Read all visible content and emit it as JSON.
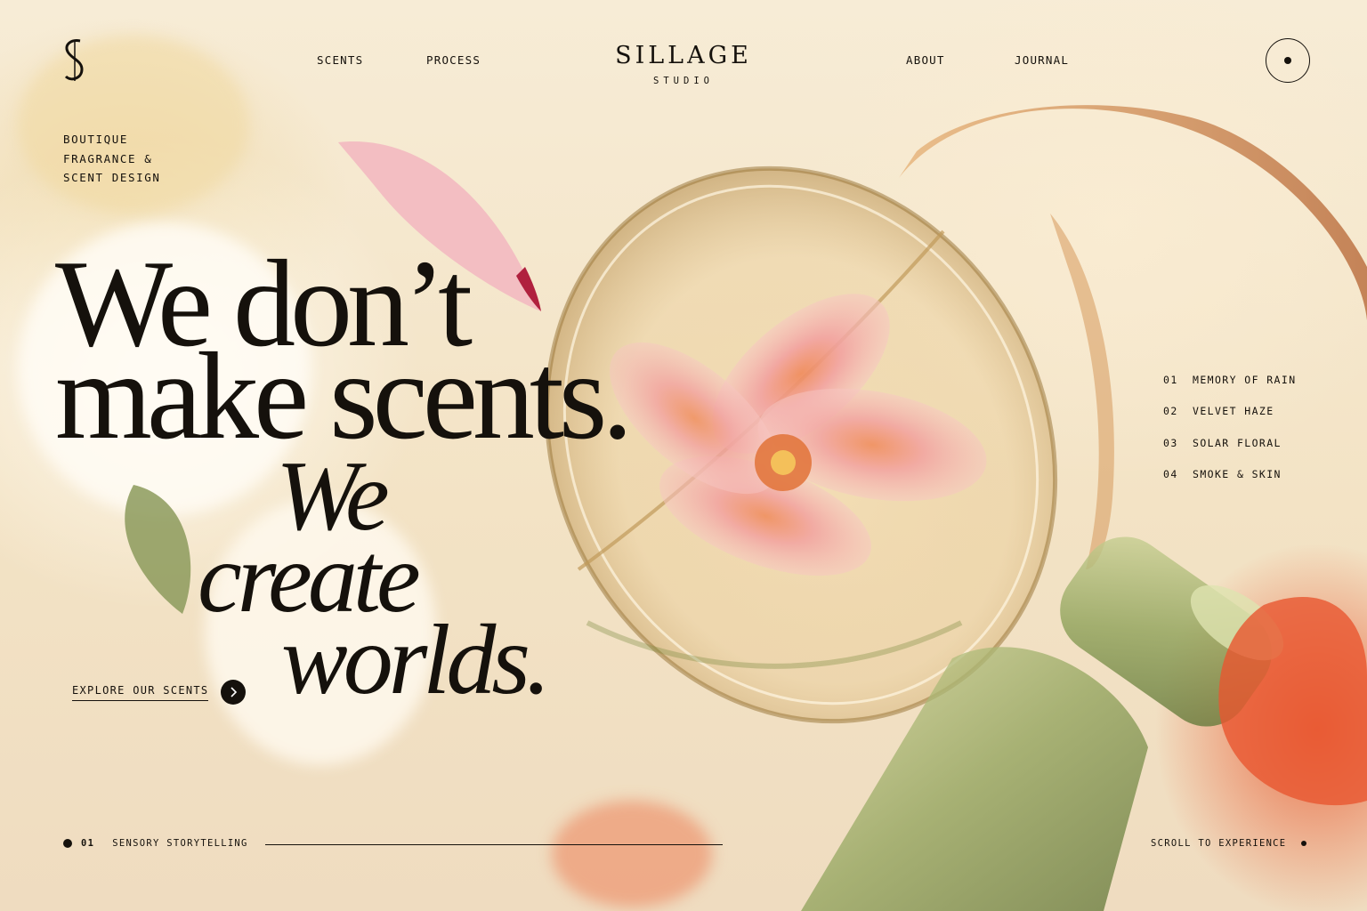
{
  "brand": {
    "name": "SILLAGE",
    "sub": "STUDIO",
    "logo_icon": "s-monogram-icon"
  },
  "nav": {
    "left": [
      "SCENTS",
      "PROCESS"
    ],
    "right": [
      "ABOUT",
      "JOURNAL"
    ]
  },
  "menu": {
    "icon": "menu-dot-icon"
  },
  "tagline": [
    "BOUTIQUE",
    "FRAGRANCE &",
    "SCENT DESIGN"
  ],
  "headline": {
    "line1": "We don’t",
    "line2": "make scents.",
    "italic1": "We",
    "italic2": "create",
    "italic3": "worlds."
  },
  "cta": {
    "label": "EXPLORE OUR SCENTS",
    "icon": "chevron-right-icon"
  },
  "scents": [
    {
      "num": "01",
      "name": "MEMORY OF RAIN"
    },
    {
      "num": "02",
      "name": "VELVET HAZE"
    },
    {
      "num": "03",
      "name": "SOLAR FLORAL"
    },
    {
      "num": "04",
      "name": "SMOKE & SKIN"
    }
  ],
  "footer": {
    "index": "01",
    "section": "SENSORY STORYTELLING",
    "scroll": "SCROLL TO EXPERIENCE"
  },
  "colors": {
    "ink": "#15110c",
    "background": "#f6ead2",
    "accent_red": "#e85c34",
    "glass_green": "#8fa25a",
    "amber": "#c98a4a"
  }
}
